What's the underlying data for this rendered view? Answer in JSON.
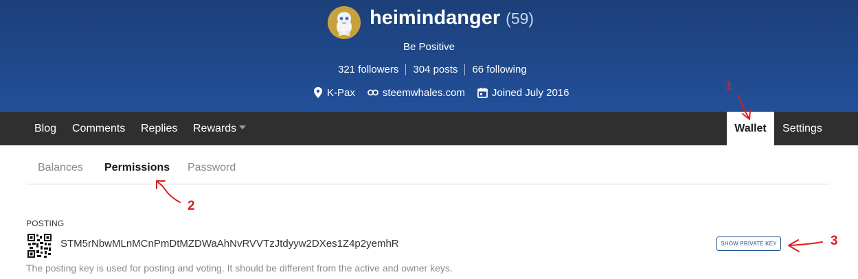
{
  "profile": {
    "username": "heimindanger",
    "reputation": "(59)",
    "about": "Be Positive",
    "stats": {
      "followers": "321 followers",
      "posts": "304 posts",
      "following": "66 following"
    },
    "location": "K-Pax",
    "website": "steemwhales.com",
    "joined": "Joined July 2016"
  },
  "nav": {
    "blog": "Blog",
    "comments": "Comments",
    "replies": "Replies",
    "rewards": "Rewards",
    "wallet": "Wallet",
    "settings": "Settings"
  },
  "tabs": {
    "balances": "Balances",
    "permissions": "Permissions",
    "password": "Password"
  },
  "posting": {
    "label": "POSTING",
    "public_key": "STM5rNbwMLnMCnPmDtMZDWaAhNvRVVTzJtdyyw2DXes1Z4p2yemhR",
    "show_private_label": "SHOW PRIVATE KEY",
    "description": "The posting key is used for posting and voting. It should be different from the active and owner keys."
  },
  "annotations": {
    "n1": "1",
    "n2": "2",
    "n3": "3",
    "color": "#e01b1b"
  },
  "colors": {
    "header_bg": "#22509a",
    "navbar_bg": "#2f2f2f",
    "button_blue": "#1a4f8f"
  }
}
